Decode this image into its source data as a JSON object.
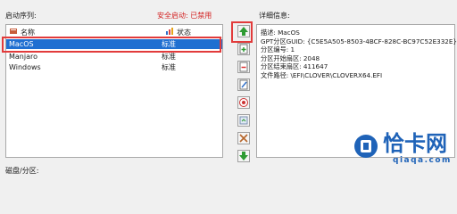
{
  "boot_order": {
    "title": "启动序列:",
    "secure_boot": "安全启动: 已禁用",
    "columns": {
      "name": "名称",
      "status": "状态"
    },
    "rows": [
      {
        "name": "MacOS",
        "status": "标准",
        "selected": true
      },
      {
        "name": "Manjaro",
        "status": "标准",
        "selected": false
      },
      {
        "name": "Windows",
        "status": "标准",
        "selected": false
      }
    ]
  },
  "toolbar": {
    "icons": [
      "move-up-icon",
      "add-entry-icon",
      "delete-entry-icon",
      "edit-entry-icon",
      "boot-target-icon",
      "backup-icon",
      "tools-icon",
      "move-down-icon"
    ]
  },
  "details": {
    "title": "详细信息:",
    "lines": [
      "描述: MacOS",
      "GPT分区GUID: {C5E5A505-8503-4BCF-828C-BC97C52E332E}",
      "分区编号: 1",
      "分区开始扇区: 2048",
      "分区结束扇区: 411647",
      "文件路径: \\EFI\\CLOVER\\CLOVERX64.EFI"
    ]
  },
  "disk_section": {
    "title": "磁盘/分区:"
  },
  "watermark": {
    "text": "恰卡网",
    "url": "qiaqa.com",
    "color": "#1f63b8"
  }
}
